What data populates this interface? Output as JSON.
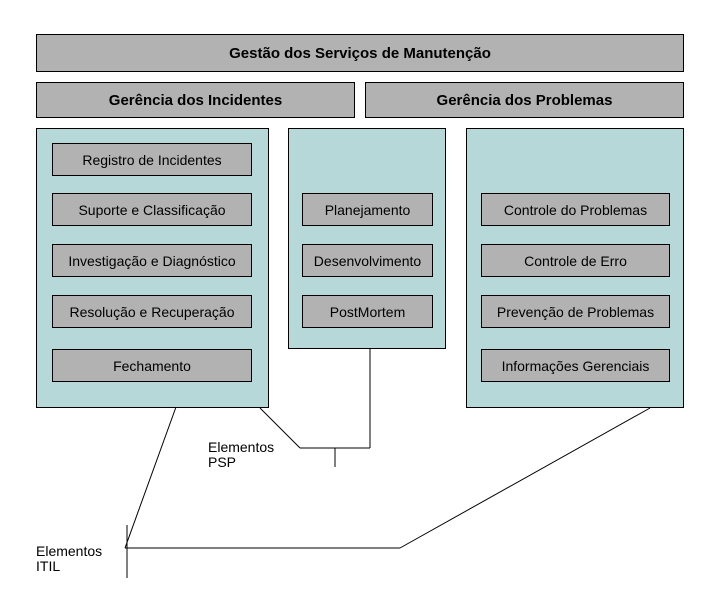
{
  "main_title": "Gestão dos Serviços de Manutenção",
  "section_left_title": "Gerência dos Incidentes",
  "section_right_title": "Gerência dos Problemas",
  "columns": {
    "incidents": {
      "items": [
        "Registro de Incidentes",
        "Suporte e Classificação",
        "Investigação e Diagnóstico",
        "Resolução e Recuperação",
        "Fechamento"
      ]
    },
    "psp": {
      "items": [
        "Planejamento",
        "Desenvolvimento",
        "PostMortem"
      ]
    },
    "problems": {
      "items": [
        "Controle do Problemas",
        "Controle de Erro",
        "Prevenção de Problemas",
        "Informações Gerenciais"
      ]
    }
  },
  "labels": {
    "psp": "Elementos PSP",
    "itil": "Elementos ITIL"
  }
}
